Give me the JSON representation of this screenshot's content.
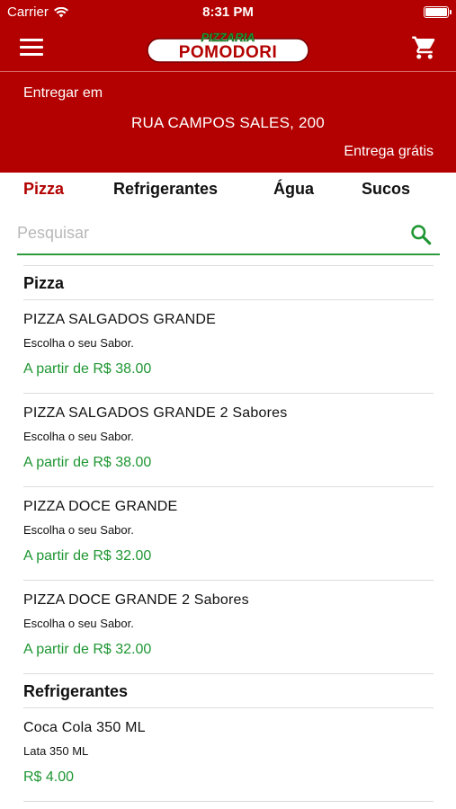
{
  "status_bar": {
    "carrier": "Carrier",
    "time": "8:31 PM"
  },
  "header": {
    "logo_top": "PIZZARIA",
    "logo_main": "POMODORI",
    "logo_colors": {
      "top_text": "#2e9b3a",
      "main_text": "#b30000",
      "pill": "#ffffff"
    },
    "menu_icon": "hamburger-menu-icon",
    "cart_icon": "shopping-cart-icon"
  },
  "delivery": {
    "label": "Entregar em",
    "address": "RUA CAMPOS SALES, 200",
    "fee": "Entrega grátis"
  },
  "tabs": [
    "Pizza",
    "Refrigerantes",
    "Água",
    "Sucos"
  ],
  "active_tab": "Pizza",
  "search": {
    "placeholder": "Pesquisar",
    "value": ""
  },
  "sections": [
    {
      "title": "Pizza",
      "items": [
        {
          "name": "PIZZA SALGADOS GRANDE",
          "desc": "Escolha o seu Sabor.",
          "price": "A partir de R$ 38.00"
        },
        {
          "name": "PIZZA SALGADOS GRANDE 2 Sabores",
          "desc": "Escolha o seu Sabor.",
          "price": "A partir de R$ 38.00"
        },
        {
          "name": "PIZZA DOCE GRANDE",
          "desc": "Escolha o seu Sabor.",
          "price": "A partir de R$ 32.00"
        },
        {
          "name": "PIZZA DOCE GRANDE 2 Sabores",
          "desc": "Escolha o seu Sabor.",
          "price": "A partir de R$ 32.00"
        }
      ]
    },
    {
      "title": "Refrigerantes",
      "items": [
        {
          "name": "Coca Cola 350 ML",
          "desc": "Lata 350 ML",
          "price": "R$ 4.00"
        }
      ]
    }
  ],
  "colors": {
    "brand_red": "#b30000",
    "price_green": "#1e9632",
    "search_underline": "#2e9b3a",
    "divider": "#dcdcdc"
  }
}
